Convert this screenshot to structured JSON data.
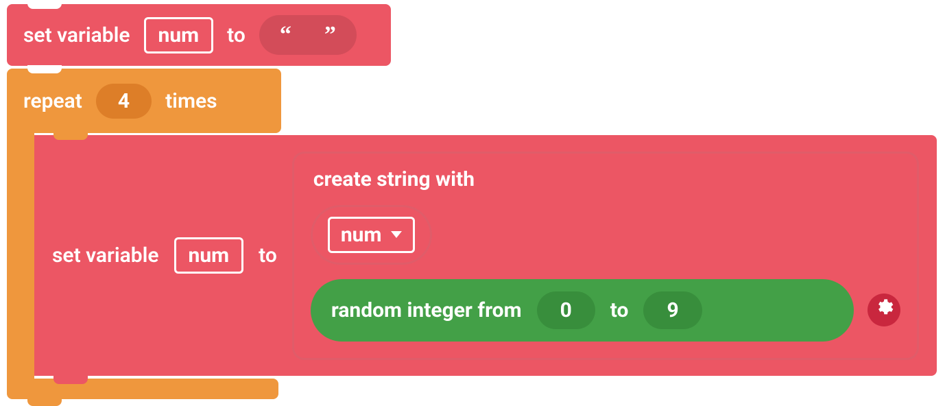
{
  "colors": {
    "variable_block": "#ec5664",
    "loop_block": "#ef973d",
    "math_block": "#43a047"
  },
  "block1": {
    "label_set_variable": "set variable",
    "var_name": "num",
    "label_to": "to",
    "string_value": ""
  },
  "block2": {
    "label_repeat": "repeat",
    "count": "4",
    "label_times": "times"
  },
  "block3": {
    "label_set_variable": "set variable",
    "var_name": "num",
    "label_to": "to",
    "create": {
      "title": "create string with",
      "dropdown_value": "num",
      "random": {
        "label_prefix": "random integer from",
        "from": "0",
        "label_to": "to",
        "to": "9"
      }
    }
  }
}
